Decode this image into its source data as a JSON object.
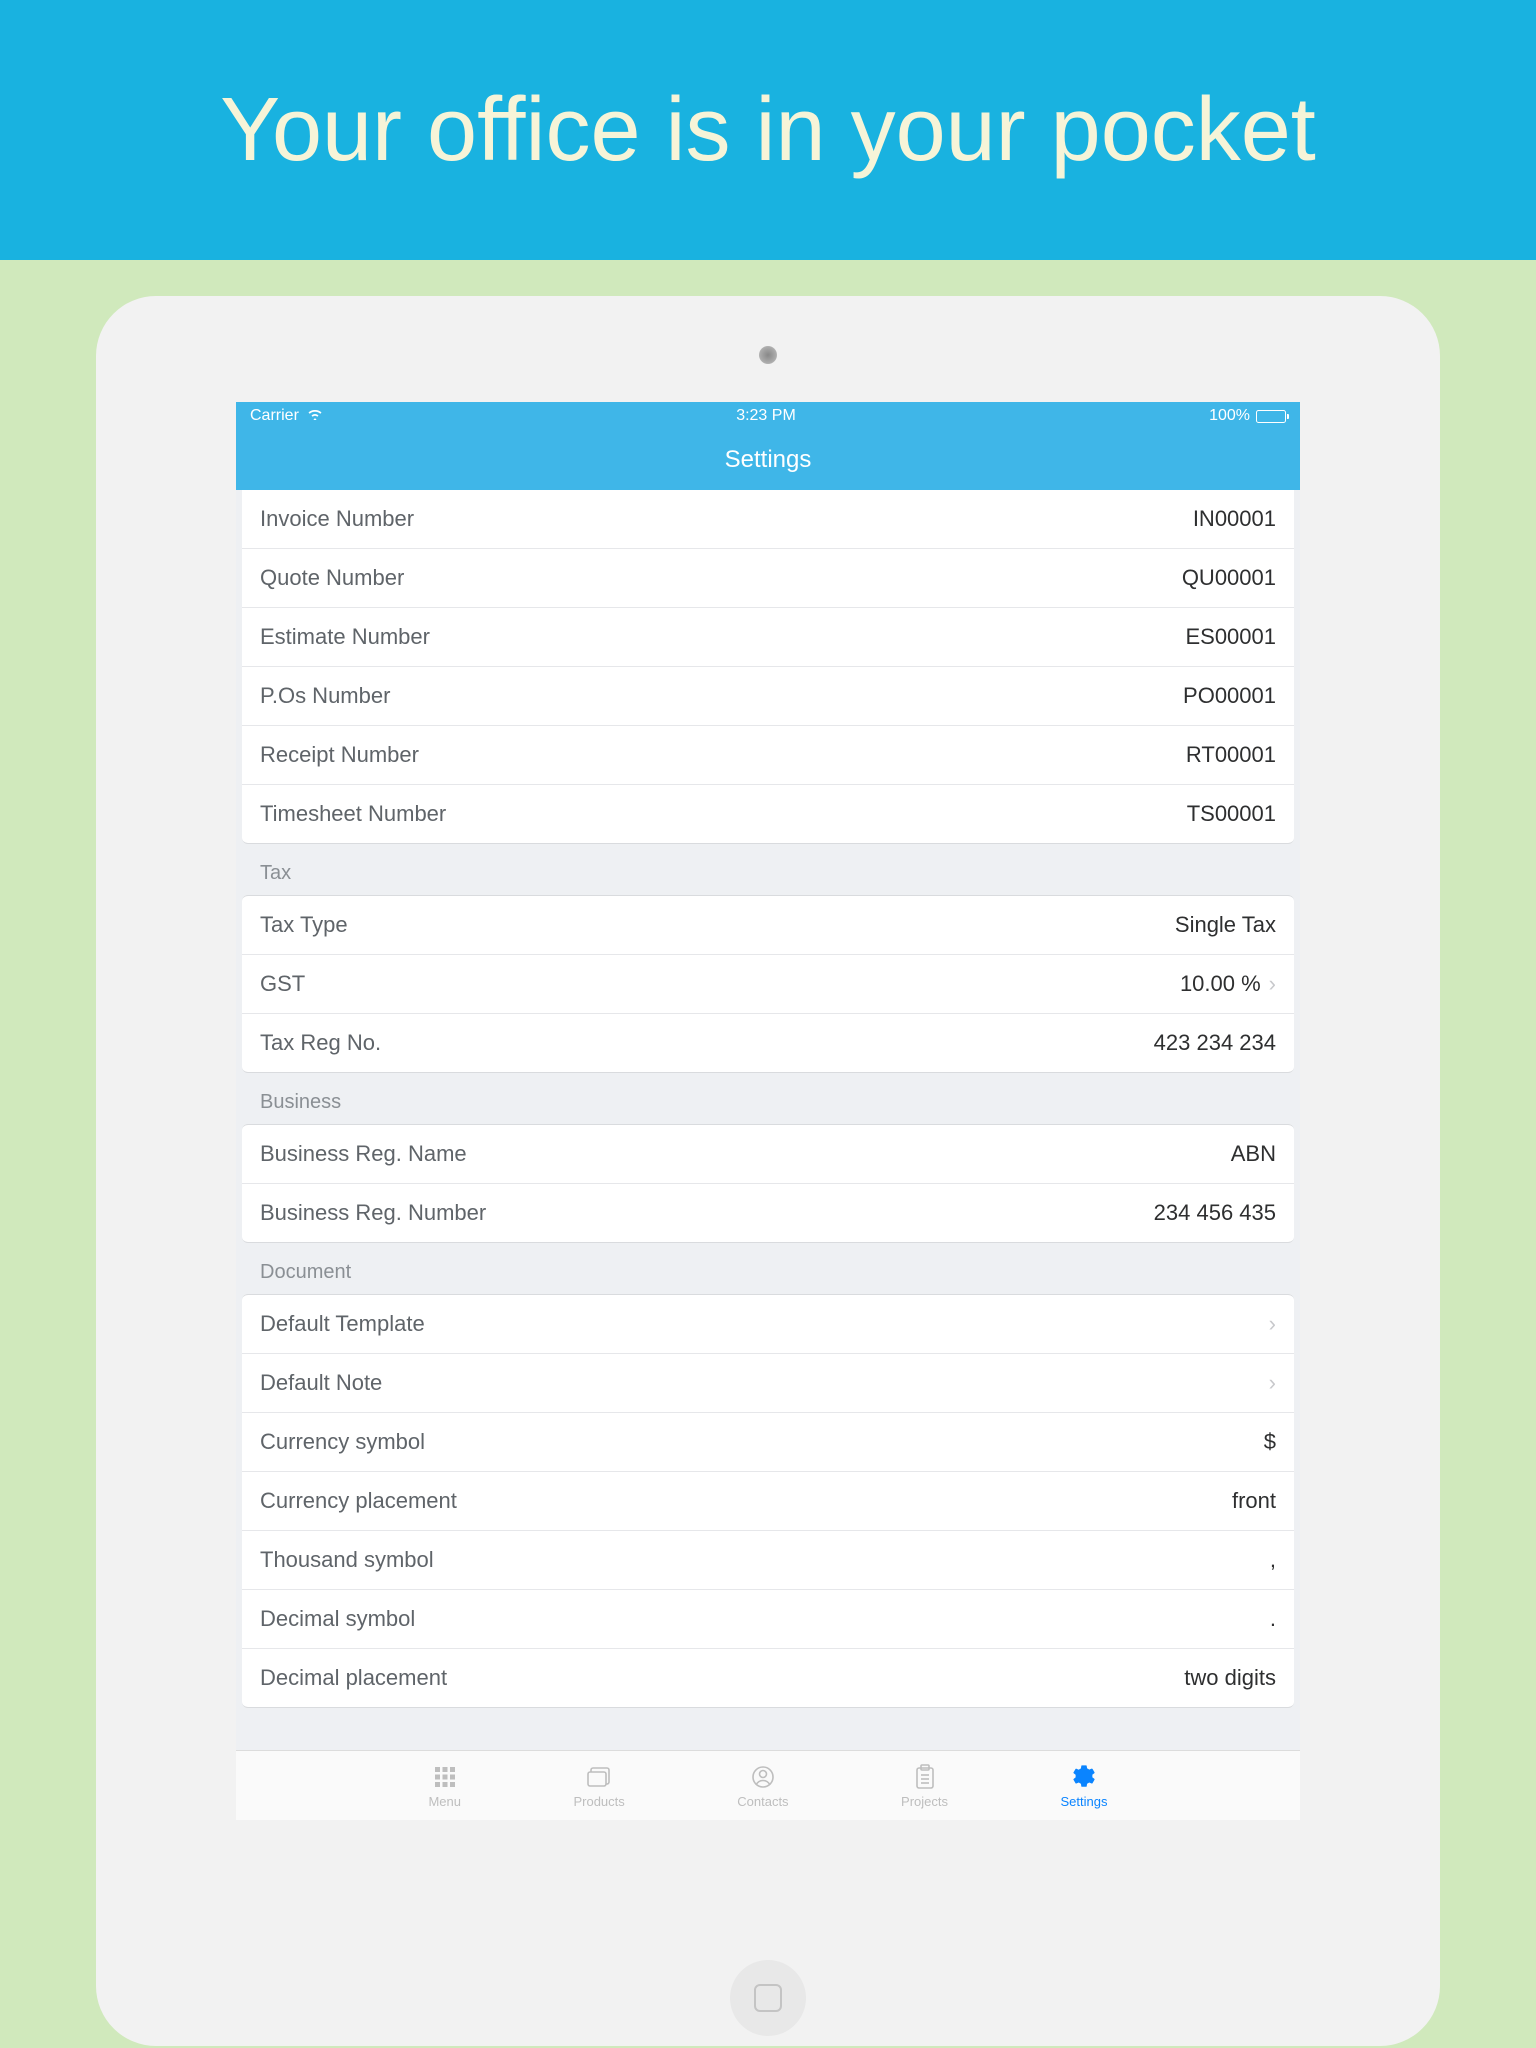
{
  "banner": {
    "text": "Your office is in your pocket"
  },
  "statusbar": {
    "carrier": "Carrier",
    "time": "3:23 PM",
    "battery": "100%"
  },
  "navbar": {
    "title": "Settings"
  },
  "sections": {
    "numbers": {
      "rows": [
        {
          "label": "Invoice Number",
          "value": "IN00001"
        },
        {
          "label": "Quote Number",
          "value": "QU00001"
        },
        {
          "label": "Estimate Number",
          "value": "ES00001"
        },
        {
          "label": "P.Os Number",
          "value": "PO00001"
        },
        {
          "label": "Receipt Number",
          "value": "RT00001"
        },
        {
          "label": "Timesheet Number",
          "value": "TS00001"
        }
      ]
    },
    "tax": {
      "header": "Tax",
      "rows": [
        {
          "label": "Tax Type",
          "value": "Single Tax"
        },
        {
          "label": "GST",
          "value": "10.00 %"
        },
        {
          "label": "Tax Reg No.",
          "value": "423 234 234"
        }
      ]
    },
    "business": {
      "header": "Business",
      "rows": [
        {
          "label": "Business Reg. Name",
          "value": "ABN"
        },
        {
          "label": "Business Reg. Number",
          "value": "234 456 435"
        }
      ]
    },
    "document": {
      "header": "Document",
      "rows": [
        {
          "label": "Default Template",
          "value": ""
        },
        {
          "label": "Default Note",
          "value": ""
        },
        {
          "label": "Currency symbol",
          "value": "$"
        },
        {
          "label": "Currency placement",
          "value": "front"
        },
        {
          "label": "Thousand symbol",
          "value": ","
        },
        {
          "label": "Decimal symbol",
          "value": "."
        },
        {
          "label": "Decimal placement",
          "value": "two digits"
        }
      ]
    }
  },
  "tabs": {
    "menu": "Menu",
    "products": "Products",
    "contacts": "Contacts",
    "projects": "Projects",
    "settings": "Settings"
  }
}
